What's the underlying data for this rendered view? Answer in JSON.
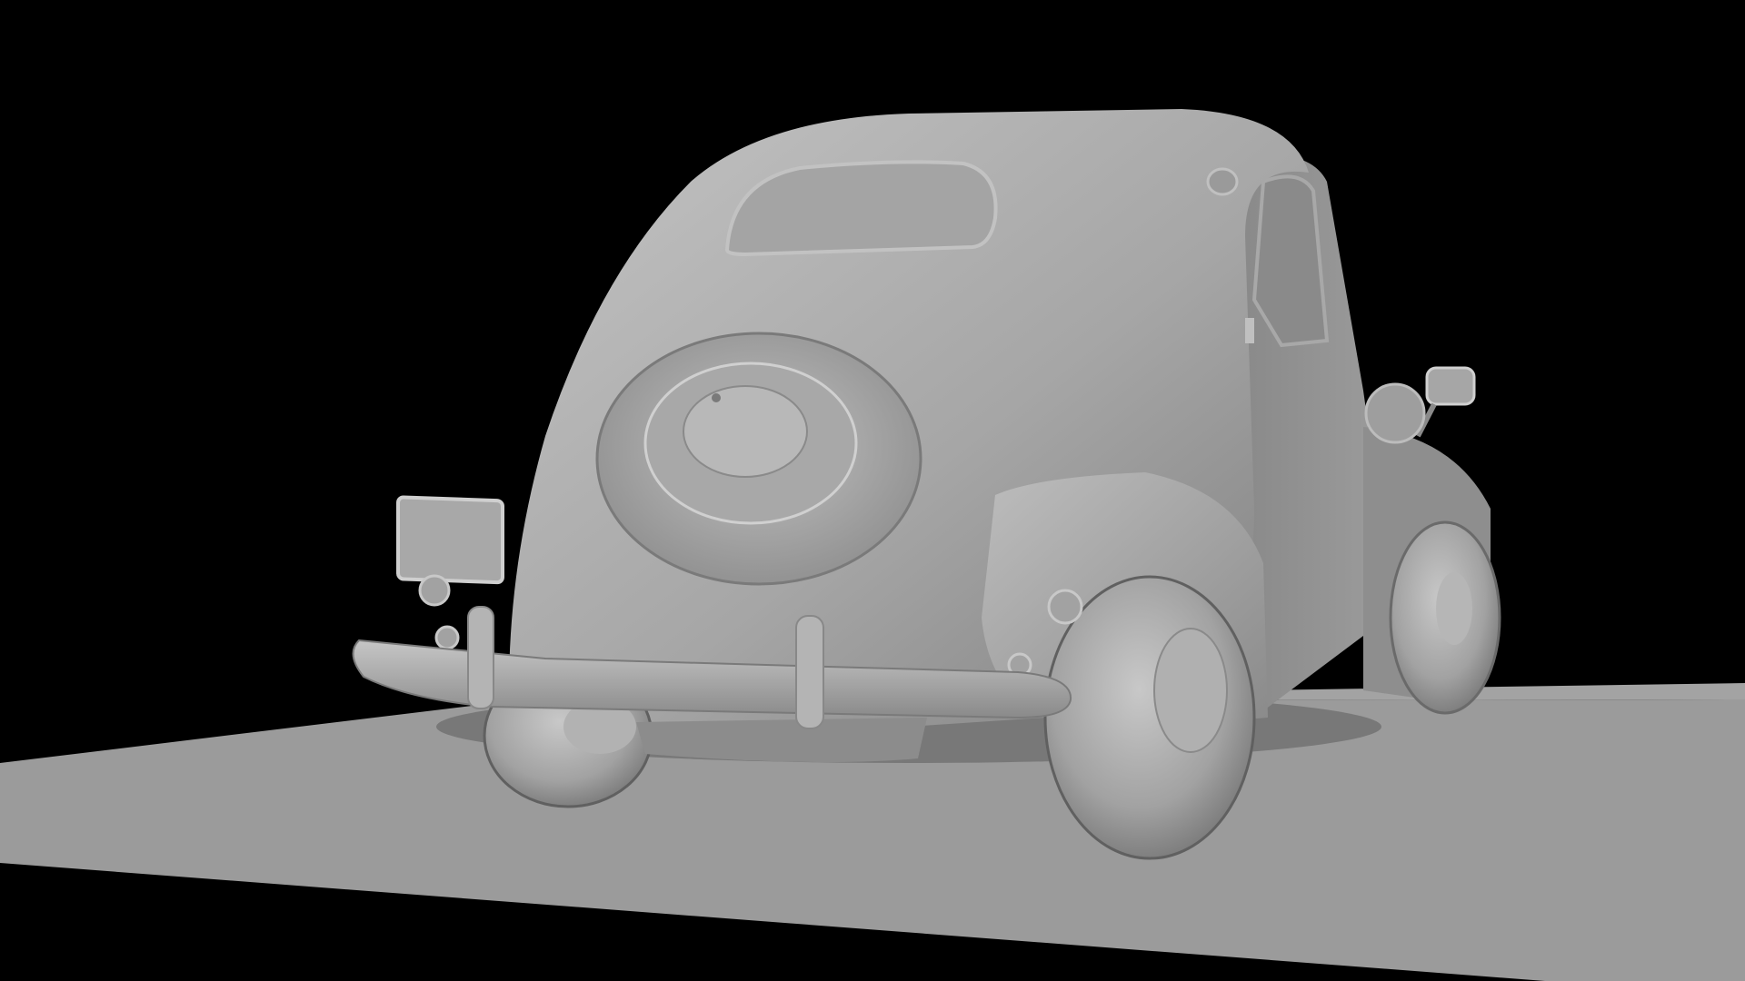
{
  "scene": {
    "subject": "car-3d-model",
    "render_style": "clay-untextured",
    "view": "rear-three-quarter"
  },
  "colors": {
    "background": "#000000",
    "floor": "#9a9a9a",
    "floor_far": "#a8a8a8",
    "body_light": "#b4b4b4",
    "body_mid": "#9c9c9c",
    "body_dark": "#6e6e6e",
    "shadow": "#4a4a4a",
    "glass": "#8c8c8c"
  }
}
